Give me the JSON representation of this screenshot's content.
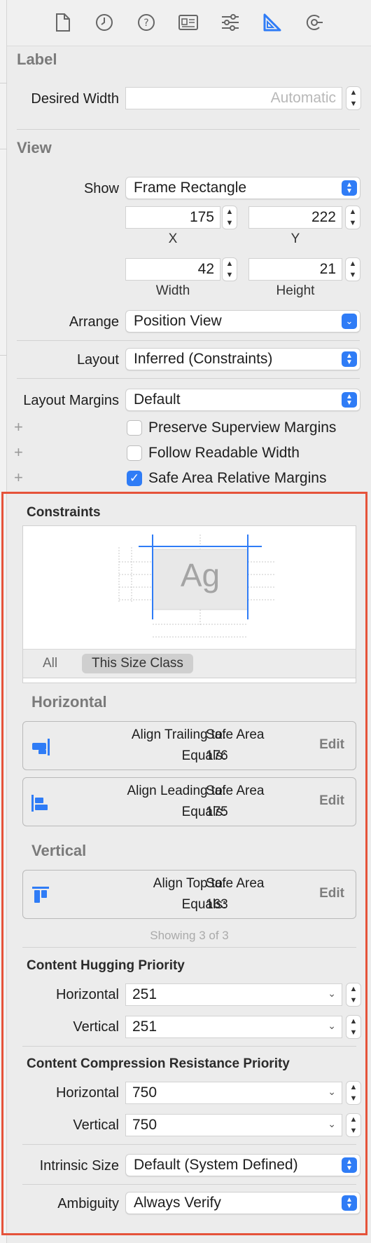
{
  "toolbar": {
    "icons": [
      "file-inspector-icon",
      "history-inspector-icon",
      "quick-help-icon",
      "identity-inspector-icon",
      "attributes-inspector-icon",
      "size-inspector-icon",
      "connections-inspector-icon"
    ]
  },
  "label_section": {
    "title": "Label",
    "desired_width_label": "Desired Width",
    "desired_width_placeholder": "Automatic"
  },
  "view_section": {
    "title": "View",
    "show_label": "Show",
    "show_value": "Frame Rectangle",
    "x_value": "175",
    "x_caption": "X",
    "y_value": "222",
    "y_caption": "Y",
    "width_value": "42",
    "width_caption": "Width",
    "height_value": "21",
    "height_caption": "Height",
    "arrange_label": "Arrange",
    "arrange_value": "Position View",
    "layout_label": "Layout",
    "layout_value": "Inferred (Constraints)",
    "layout_margins_label": "Layout Margins",
    "layout_margins_value": "Default",
    "preserve_superview_margins": "Preserve Superview Margins",
    "follow_readable_width": "Follow Readable Width",
    "safe_area_relative_margins": "Safe Area Relative Margins",
    "plus": "+"
  },
  "constraints": {
    "title": "Constraints",
    "preview_text": "Ag",
    "seg_all": "All",
    "seg_size_class": "This Size Class",
    "horizontal_title": "Horizontal",
    "vertical_title": "Vertical",
    "edit_label": "Edit",
    "equals_label": "Equals:",
    "items": [
      {
        "relation": "Align Trailing to:",
        "target": "Safe Area",
        "value": "176"
      },
      {
        "relation": "Align Leading to:",
        "target": "Safe Area",
        "value": "175"
      },
      {
        "relation": "Align Top to:",
        "target": "Safe Area",
        "value": "163"
      }
    ],
    "showing": "Showing 3 of 3"
  },
  "hugging": {
    "title": "Content Hugging Priority",
    "horizontal_label": "Horizontal",
    "horizontal_value": "251",
    "vertical_label": "Vertical",
    "vertical_value": "251"
  },
  "compression": {
    "title": "Content Compression Resistance Priority",
    "horizontal_label": "Horizontal",
    "horizontal_value": "750",
    "vertical_label": "Vertical",
    "vertical_value": "750"
  },
  "intrinsic": {
    "label": "Intrinsic Size",
    "value": "Default (System Defined)"
  },
  "ambiguity": {
    "label": "Ambiguity",
    "value": "Always Verify"
  },
  "colors": {
    "accent": "#2f7cf6",
    "highlight_border": "#e5533a"
  }
}
